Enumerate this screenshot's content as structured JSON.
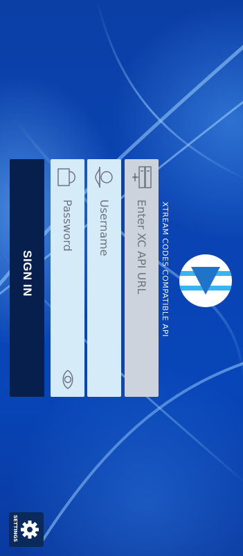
{
  "app": {
    "tagline": "XTREAM CODES COMPATIBLE API",
    "logo_icon": "play-down-triangle-logo",
    "accent_color": "#38b4ef"
  },
  "form": {
    "url_field": {
      "placeholder": "Enter XC API URL",
      "value": "",
      "icon": "server-network-icon"
    },
    "username_field": {
      "placeholder": "Username",
      "value": "",
      "icon": "user-icon"
    },
    "password_field": {
      "placeholder": "Password",
      "value": "",
      "icon": "lock-icon",
      "toggle_icon": "eye-icon"
    },
    "signin_label": "SIGN IN"
  },
  "settings": {
    "label": "SETTINGS",
    "icon": "gear-icon"
  }
}
